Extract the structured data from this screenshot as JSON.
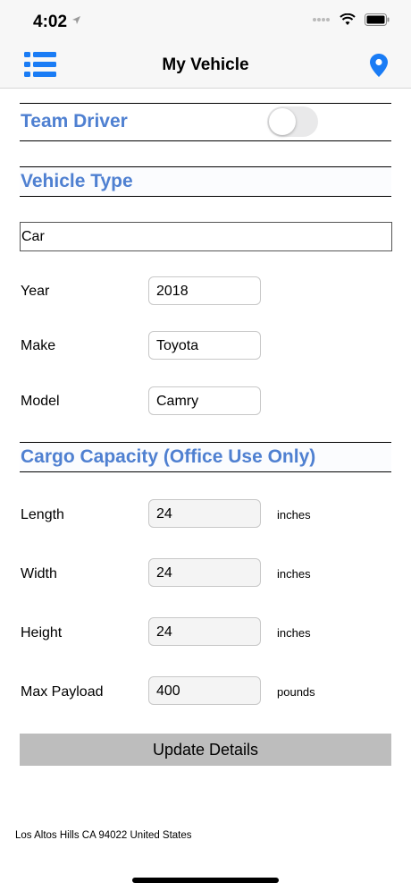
{
  "status_bar": {
    "time": "4:02"
  },
  "nav": {
    "title": "My Vehicle"
  },
  "team_driver": {
    "label": "Team Driver",
    "enabled": false
  },
  "vehicle_type": {
    "section_title": "Vehicle Type",
    "value": "Car"
  },
  "vehicle_fields": [
    {
      "label": "Year",
      "value": "2018"
    },
    {
      "label": "Make",
      "value": "Toyota"
    },
    {
      "label": "Model",
      "value": "Camry"
    }
  ],
  "cargo": {
    "section_title": "Cargo Capacity (Office Use Only)",
    "fields": [
      {
        "label": "Length",
        "value": "24",
        "unit": "inches"
      },
      {
        "label": "Width",
        "value": "24",
        "unit": "inches"
      },
      {
        "label": "Height",
        "value": "24",
        "unit": "inches"
      },
      {
        "label": "Max Payload",
        "value": "400",
        "unit": "pounds"
      }
    ]
  },
  "update_button": {
    "label": "Update Details"
  },
  "footer": {
    "address": "Los Altos Hills CA 94022 United States"
  },
  "colors": {
    "accent": "#4f80d1",
    "nav_blue": "#1a7cf5",
    "button_gray": "#bdbdbd"
  }
}
